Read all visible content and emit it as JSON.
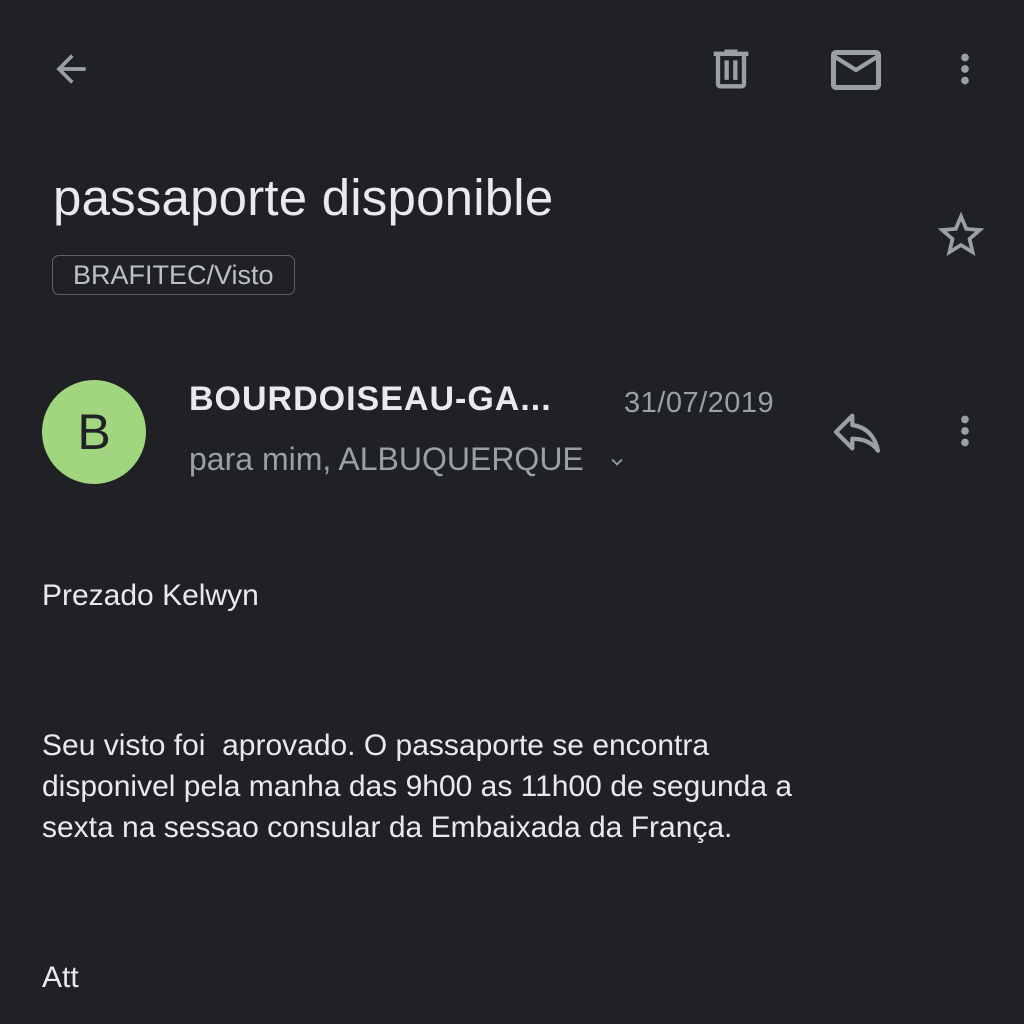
{
  "toolbar": {
    "back_icon": "arrow-back-icon",
    "delete_icon": "trash-icon",
    "mark_unread_icon": "mail-icon",
    "more_icon": "more-vert-icon"
  },
  "subject": {
    "title": "passaporte disponible",
    "label": "BRAFITEC/Visto",
    "star_icon": "star-outline-icon"
  },
  "sender": {
    "avatar_letter": "B",
    "avatar_color": "#a1d57f",
    "name": "BOURDOISEAU-GA...",
    "date": "31/07/2019",
    "recipients": "para mim, ALBUQUERQUE",
    "reply_icon": "reply-icon",
    "more_icon": "more-vert-icon"
  },
  "message": {
    "greeting": "Prezado Kelwyn",
    "line1": "Seu visto foi  aprovado. O passaporte se encontra",
    "line2": "disponivel pela manha das 9h00 as 11h00 de segunda a",
    "line3": "sexta na sessao consular da Embaixada da França.",
    "signoff": "Att"
  },
  "colors": {
    "background": "#202124",
    "text_primary": "#e8eaed",
    "text_secondary": "#9aa0a6",
    "icon": "#9aa0a6"
  }
}
